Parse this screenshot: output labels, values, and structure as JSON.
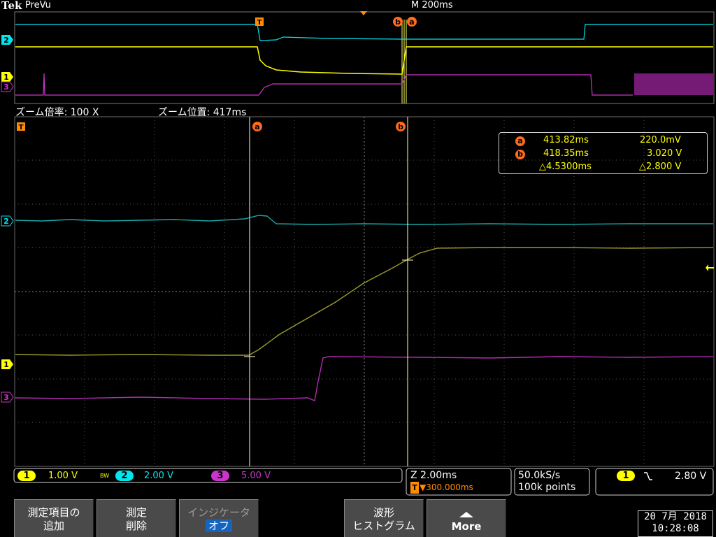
{
  "header": {
    "brand": "Tek",
    "mode": "PreVu",
    "timebase": "M 200ms"
  },
  "zoom": {
    "factor": "ズーム倍率: 100 X",
    "position": "ズーム位置: 417ms"
  },
  "markers": {
    "trigger": "T",
    "cursor_a": "a",
    "cursor_b": "b"
  },
  "channel_markers": [
    "1",
    "2",
    "3"
  ],
  "readout": {
    "a_time": "413.82ms",
    "a_value": "220.0mV",
    "b_time": "418.35ms",
    "b_value": "3.020 V",
    "delta_time": "△4.5300ms",
    "delta_value": "△2.800 V"
  },
  "channels": {
    "ch1": {
      "num": "1",
      "scale": "1.00 V",
      "bw": "BW",
      "color": "#ffff00"
    },
    "ch2": {
      "num": "2",
      "scale": "2.00 V",
      "color": "#00e5ee"
    },
    "ch3": {
      "num": "3",
      "scale": "5.00 V",
      "color": "#cc33cc"
    }
  },
  "zoom_box": {
    "scale": "Z 2.00ms",
    "trig_pos_icon": "T",
    "trig_pos": "▼300.000ms"
  },
  "acquisition": {
    "rate": "50.0kS/s",
    "points": "100k points"
  },
  "trigger": {
    "source": "1",
    "slope_icon": "falling-edge-icon",
    "level": "2.80 V"
  },
  "softkeys": {
    "add_measurement": [
      "測定項目の",
      "追加"
    ],
    "remove_measurement": [
      "測定",
      "削除"
    ],
    "indicator": [
      "インジケータ",
      "オフ"
    ],
    "waveform_histogram": [
      "波形",
      "ヒストグラム"
    ],
    "more": "More"
  },
  "datetime": {
    "date": "20 7月  2018",
    "time": "10:28:08"
  }
}
